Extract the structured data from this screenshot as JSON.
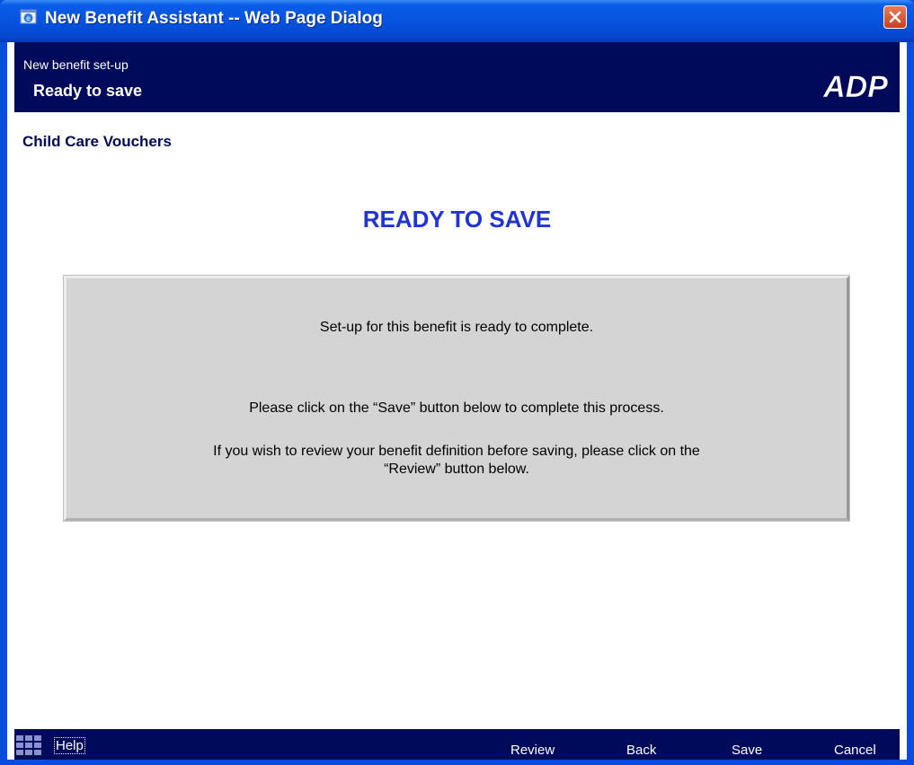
{
  "window": {
    "title": "New Benefit Assistant -- Web Page Dialog",
    "icon": "ie-icon",
    "close_icon": "close-icon"
  },
  "header": {
    "subtitle": "New benefit set-up",
    "title": "Ready to save",
    "logo_text": "ADP"
  },
  "content": {
    "benefit_name": "Child Care Vouchers",
    "heading": "READY TO SAVE",
    "messages": [
      "Set-up for this benefit is ready to complete.",
      "Please click on the “Save” button below to complete this process.",
      "If you wish to review your benefit definition before saving, please click on the",
      "“Review” button below."
    ]
  },
  "footer": {
    "help_label": "Help",
    "buttons": {
      "review": "Review",
      "back": "Back",
      "save": "Save",
      "cancel": "Cancel"
    }
  },
  "colors": {
    "titlebar": "#0654df",
    "banner": "#000a5a",
    "heading": "#1f33d6",
    "box": "#d4d4d4"
  }
}
